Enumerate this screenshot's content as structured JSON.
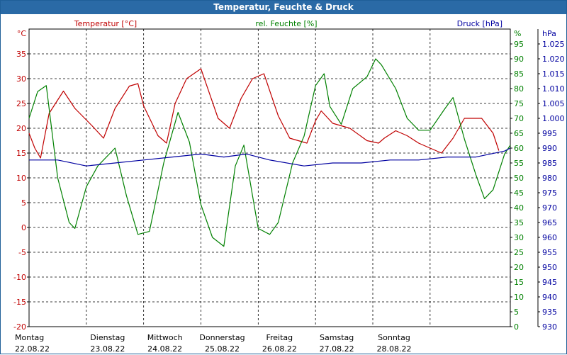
{
  "window": {
    "title": "Temperatur, Feuchte & Druck"
  },
  "chart_data": {
    "type": "line",
    "title": "Temperatur, Feuchte & Druck",
    "grid": true,
    "axes": {
      "temperature": {
        "label": "Temperatur [°C]",
        "unit": "°C",
        "color": "#c00000",
        "range": [
          -20,
          40
        ],
        "ticks": [
          "-20",
          "-15",
          "-10",
          "-5",
          "0",
          "5",
          "10",
          "15",
          "20",
          "25",
          "30",
          "35"
        ]
      },
      "humidity": {
        "label": "rel. Feuchte [%]",
        "unit": "%",
        "color": "#008000",
        "range": [
          0,
          100
        ],
        "ticks": [
          "0",
          "5",
          "10",
          "15",
          "20",
          "25",
          "30",
          "35",
          "40",
          "45",
          "50",
          "55",
          "60",
          "65",
          "70",
          "75",
          "80",
          "85",
          "90",
          "95"
        ]
      },
      "pressure": {
        "label": "Druck [hPa]",
        "unit": "hPa",
        "color": "#0000a0",
        "range": [
          930,
          1030
        ],
        "ticks": [
          "930",
          "935",
          "940",
          "945",
          "950",
          "955",
          "960",
          "965",
          "970",
          "975",
          "980",
          "985",
          "990",
          "995",
          "1.000",
          "1.005",
          "1.010",
          "1.015",
          "1.020",
          "1.025"
        ]
      }
    },
    "x_range": [
      0,
      7
    ],
    "days": [
      {
        "weekday": "Montag",
        "date": "22.08.22"
      },
      {
        "weekday": "Dienstag",
        "date": "23.08.22"
      },
      {
        "weekday": "Mittwoch",
        "date": "24.08.22"
      },
      {
        "weekday": "Donnerstag",
        "date": "25.08.22"
      },
      {
        "weekday": "Freitag",
        "date": "26.08.22"
      },
      {
        "weekday": "Samstag",
        "date": "27.08.22"
      },
      {
        "weekday": "Sonntag",
        "date": "28.08.22"
      }
    ],
    "series": [
      {
        "name": "Temperatur [°C]",
        "axis": "temperature",
        "color": "#c00000",
        "points": [
          [
            0,
            19
          ],
          [
            0.1,
            16
          ],
          [
            0.2,
            14
          ],
          [
            0.35,
            23
          ],
          [
            0.6,
            27.5
          ],
          [
            0.8,
            24
          ],
          [
            1.1,
            20.5
          ],
          [
            1.3,
            18
          ],
          [
            1.5,
            24
          ],
          [
            1.75,
            28.5
          ],
          [
            1.9,
            29
          ],
          [
            2.0,
            24.5
          ],
          [
            2.25,
            18.5
          ],
          [
            2.4,
            17
          ],
          [
            2.55,
            25
          ],
          [
            2.75,
            30
          ],
          [
            3.0,
            32
          ],
          [
            3.3,
            22
          ],
          [
            3.5,
            20
          ],
          [
            3.7,
            26
          ],
          [
            3.9,
            30
          ],
          [
            4.1,
            31
          ],
          [
            4.35,
            22.5
          ],
          [
            4.55,
            18
          ],
          [
            4.85,
            17
          ],
          [
            5.0,
            21.5
          ],
          [
            5.1,
            23.5
          ],
          [
            5.3,
            21
          ],
          [
            5.6,
            20
          ],
          [
            5.9,
            17.5
          ],
          [
            6.1,
            17
          ],
          [
            6.2,
            18
          ],
          [
            6.4,
            19.5
          ],
          [
            6.6,
            18.5
          ],
          [
            6.8,
            17
          ],
          [
            7.0,
            16
          ],
          [
            7.2,
            15
          ],
          [
            7.4,
            18
          ],
          [
            7.6,
            22
          ],
          [
            7.9,
            22
          ],
          [
            8.1,
            19
          ],
          [
            8.2,
            15.5
          ]
        ]
      },
      {
        "name": "rel. Feuchte [%]",
        "axis": "humidity",
        "color": "#008000",
        "points": [
          [
            0,
            70
          ],
          [
            0.15,
            79
          ],
          [
            0.3,
            81
          ],
          [
            0.5,
            50
          ],
          [
            0.7,
            35
          ],
          [
            0.8,
            33
          ],
          [
            1.0,
            47
          ],
          [
            1.2,
            54
          ],
          [
            1.5,
            60
          ],
          [
            1.7,
            44
          ],
          [
            1.9,
            31
          ],
          [
            2.1,
            32
          ],
          [
            2.35,
            55
          ],
          [
            2.6,
            72
          ],
          [
            2.8,
            62
          ],
          [
            3.0,
            41
          ],
          [
            3.2,
            30
          ],
          [
            3.4,
            27
          ],
          [
            3.6,
            54
          ],
          [
            3.75,
            61
          ],
          [
            3.9,
            44
          ],
          [
            4.0,
            33
          ],
          [
            4.2,
            31
          ],
          [
            4.35,
            35
          ],
          [
            4.6,
            55
          ],
          [
            4.8,
            64
          ],
          [
            5.0,
            81
          ],
          [
            5.15,
            85
          ],
          [
            5.25,
            74
          ],
          [
            5.45,
            68
          ],
          [
            5.65,
            80
          ],
          [
            5.9,
            84
          ],
          [
            6.05,
            90
          ],
          [
            6.15,
            88
          ],
          [
            6.4,
            80
          ],
          [
            6.6,
            70
          ],
          [
            6.8,
            66
          ],
          [
            7.0,
            66
          ],
          [
            7.25,
            73
          ],
          [
            7.4,
            77
          ],
          [
            7.6,
            63
          ],
          [
            7.8,
            51
          ],
          [
            7.95,
            43
          ],
          [
            8.1,
            46
          ],
          [
            8.3,
            58
          ],
          [
            8.4,
            61
          ]
        ]
      },
      {
        "name": "Druck [hPa]",
        "axis": "pressure",
        "color": "#0000a0",
        "points": [
          [
            0,
            986
          ],
          [
            0.5,
            986
          ],
          [
            1.0,
            984
          ],
          [
            1.5,
            985
          ],
          [
            2.0,
            986
          ],
          [
            2.5,
            987
          ],
          [
            3.0,
            988
          ],
          [
            3.4,
            987
          ],
          [
            3.8,
            988
          ],
          [
            4.2,
            986
          ],
          [
            4.8,
            984
          ],
          [
            5.3,
            985
          ],
          [
            5.8,
            985
          ],
          [
            6.3,
            986
          ],
          [
            6.8,
            986
          ],
          [
            7.3,
            987
          ],
          [
            7.8,
            987
          ],
          [
            8.3,
            989
          ],
          [
            8.4,
            990
          ]
        ]
      }
    ]
  }
}
